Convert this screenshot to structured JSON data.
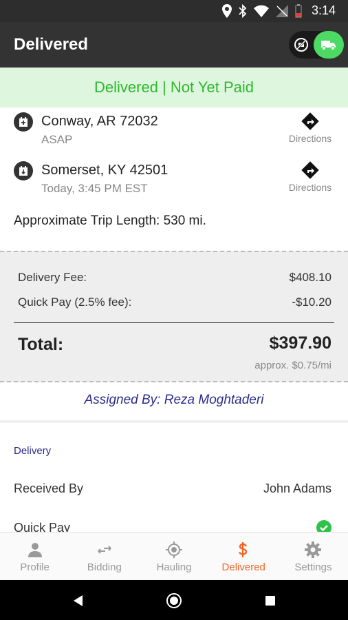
{
  "status_bar": {
    "time": "3:14"
  },
  "header": {
    "title": "Delivered"
  },
  "banner": {
    "text": "Delivered | Not Yet Paid"
  },
  "stops": [
    {
      "city": "Conway, AR 72032",
      "time": "ASAP",
      "directions_label": "Directions"
    },
    {
      "city": "Somerset, KY 42501",
      "time": "Today, 3:45 PM EST",
      "directions_label": "Directions"
    }
  ],
  "trip": {
    "length_text": "Approximate Trip Length: 530 mi."
  },
  "fees": {
    "delivery_fee_label": "Delivery Fee:",
    "delivery_fee_value": "$408.10",
    "quick_pay_label": "Quick Pay (2.5% fee):",
    "quick_pay_value": "-$10.20",
    "total_label": "Total:",
    "total_value": "$397.90",
    "per_mile": "approx. $0.75/mi"
  },
  "assigned_by": "Assigned By: Reza Moghtaderi",
  "delivery_section": {
    "title": "Delivery",
    "received_by_label": "Received By",
    "received_by_value": "John Adams",
    "quick_pay_label": "Quick Pay",
    "quick_pay_checked": true
  },
  "tabs": [
    {
      "label": "Profile",
      "icon": "person-icon"
    },
    {
      "label": "Bidding",
      "icon": "swap-arrows-icon"
    },
    {
      "label": "Hauling",
      "icon": "crosshair-icon"
    },
    {
      "label": "Delivered",
      "icon": "dollar-icon"
    },
    {
      "label": "Settings",
      "icon": "gear-icon"
    }
  ],
  "colors": {
    "banner_text": "#2eb82e",
    "banner_bg": "#ddf6dd",
    "active_tab": "#f26522",
    "accent_blue": "#2b2b8c",
    "toggle_green": "#4cd964"
  }
}
